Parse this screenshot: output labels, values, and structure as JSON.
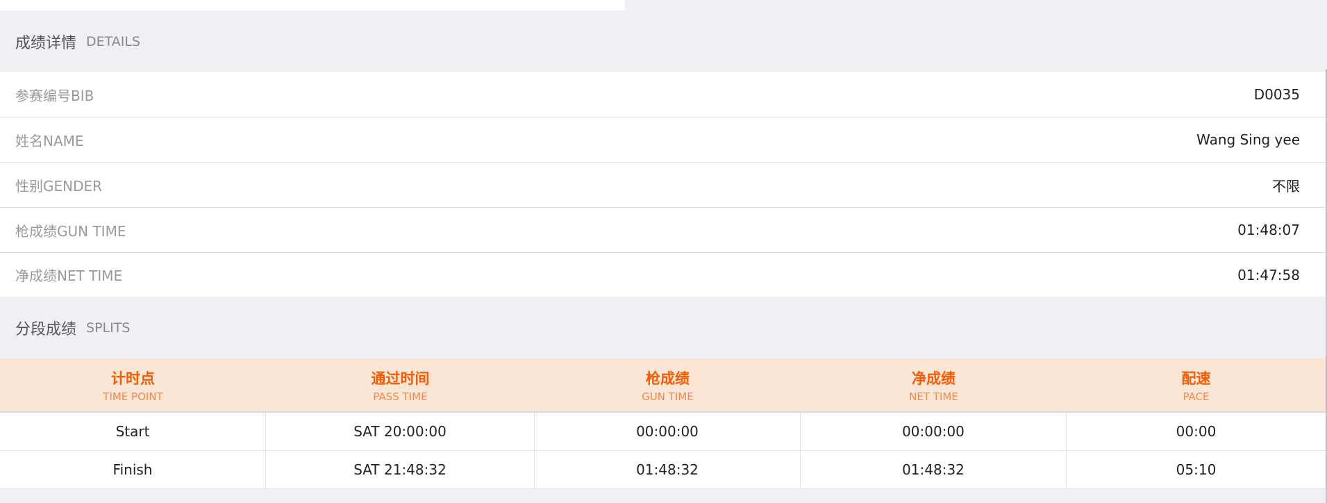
{
  "top_strip": {
    "cut_text": ""
  },
  "details": {
    "title_cn": "成绩详情",
    "title_en": "DETAILS",
    "rows": [
      {
        "label": "参赛编号BIB",
        "value": "D0035"
      },
      {
        "label": "姓名NAME",
        "value": "Wang Sing yee"
      },
      {
        "label": "性别GENDER",
        "value": "不限"
      },
      {
        "label": "枪成绩GUN TIME",
        "value": "01:48:07"
      },
      {
        "label": "净成绩NET TIME",
        "value": "01:47:58"
      }
    ]
  },
  "splits": {
    "title_cn": "分段成绩",
    "title_en": "SPLITS",
    "columns": [
      {
        "cn": "计时点",
        "en": "TIME POINT"
      },
      {
        "cn": "通过时间",
        "en": "PASS TIME"
      },
      {
        "cn": "枪成绩",
        "en": "GUN TIME"
      },
      {
        "cn": "净成绩",
        "en": "NET TIME"
      },
      {
        "cn": "配速",
        "en": "PACE"
      }
    ],
    "rows": [
      [
        "Start",
        "SAT 20:00:00",
        "00:00:00",
        "00:00:00",
        "00:00"
      ],
      [
        "Finish",
        "SAT 21:48:32",
        "01:48:32",
        "01:48:32",
        "05:10"
      ]
    ]
  },
  "colors": {
    "accent": "#f25c05",
    "header_bg": "#fbe6d6",
    "page_bg": "#efeff4"
  }
}
